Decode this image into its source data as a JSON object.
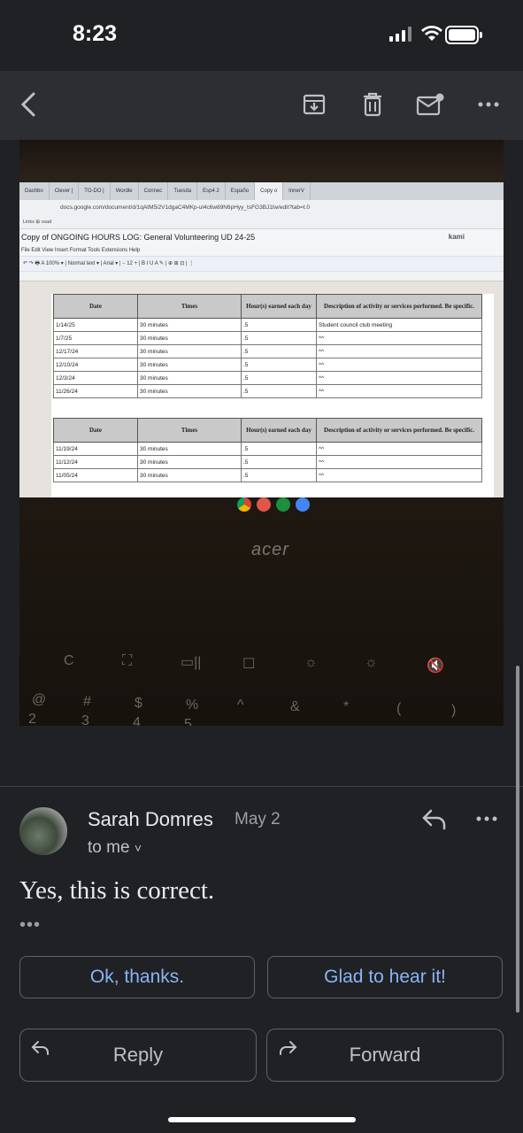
{
  "status_bar": {
    "time": "8:23"
  },
  "toolbar": {
    "back_icon": "chevron-left-icon",
    "archive_icon": "archive-icon",
    "delete_icon": "trash-icon",
    "mark_unread_icon": "mail-unread-icon",
    "more_icon": "more-horizontal-icon"
  },
  "photo": {
    "tabs": [
      "Dashbo",
      "Clever |",
      "TO-DO |",
      "Wordle",
      "Connec",
      "Tuesda",
      "Esp4 2",
      "Españo",
      "Copy o",
      "InnerV"
    ],
    "url": "docs.google.com/document/d/1qAtM5i2V1dgaC4MKp-ul4c6w89N6pHyy_tsFG3BJ1lw/edit?tab=t.0",
    "bookmarks": "Links  ⊞  vsad",
    "doc_title": "Copy of ONGOING HOURS LOG: General Volunteering UD 24-25",
    "kami": "kami",
    "menu": "File   Edit   View   Insert   Format   Tools   Extensions   Help",
    "format_bar": "↶  ↷  🖶  A  100%  ▾  |  Normal text  ▾  |  Arial  ▾  |  −  12  +  |  B  I  U  A  ✎  |  ⊕  ⊞  ⊡  |  ⋮",
    "table_headers": [
      "Date",
      "Times",
      "Hour(s) earned each day",
      "Description of activity or services performed. Be specific."
    ],
    "table1_rows": [
      [
        "1/14/25",
        "30 minutes",
        ".5",
        "Student council club meeting"
      ],
      [
        "1/7/25",
        "30 minutes",
        ".5",
        "^^"
      ],
      [
        "12/17/24",
        "30 minutes",
        ".5",
        "^^"
      ],
      [
        "12/10/24",
        "30 minutes",
        ".5",
        "^^"
      ],
      [
        "12/3/24",
        "30 minutes",
        ".5",
        "^^"
      ],
      [
        "11/26/24",
        "30 minutes",
        ".5",
        "^^"
      ]
    ],
    "table2_rows": [
      [
        "11/19/24",
        "30 minutes",
        ".5",
        "^^"
      ],
      [
        "11/12/24",
        "30 minutes",
        ".5",
        "^^"
      ],
      [
        "11/05/24",
        "30 minutes",
        ".5",
        "^^"
      ]
    ],
    "laptop_brand": "acer",
    "keys": [
      "C",
      "⛶",
      "▭||",
      "☐",
      "☼",
      "☼",
      "🔇",
      "@",
      "#",
      "$",
      "%",
      "^",
      "&",
      "*",
      "(",
      ")",
      "2",
      "3",
      "4",
      "5"
    ]
  },
  "email": {
    "sender": "Sarah Domres",
    "date": "May 2",
    "recipient": "to me",
    "recipient_caret": "˅",
    "body": "Yes, this is correct.",
    "quoted_toggle": "•••",
    "smart_replies": [
      "Ok, thanks.",
      "Glad to hear it!"
    ],
    "reply_label": "Reply",
    "forward_label": "Forward"
  },
  "colors": {
    "background": "#202124",
    "toolbar": "#2d2e31",
    "link_blue": "#8ab4f8",
    "border": "#5f6368"
  }
}
